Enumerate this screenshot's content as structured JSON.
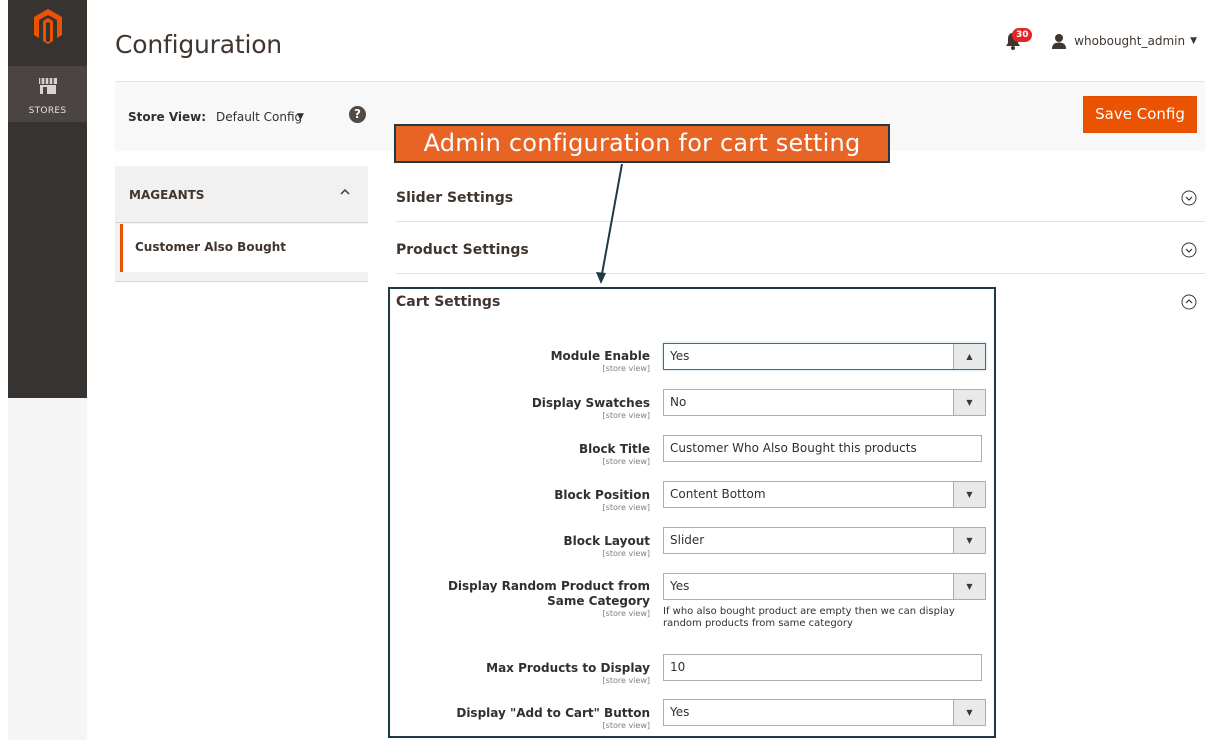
{
  "sidebar": {
    "logo_icon": "magento-logo-icon",
    "stores_label": "STORES"
  },
  "header": {
    "title": "Configuration",
    "notifications_count": "30",
    "username": "whobought_admin"
  },
  "store_view": {
    "label": "Store View:",
    "value": "Default Config"
  },
  "actions": {
    "save_label": "Save Config"
  },
  "annotation": {
    "text": "Admin configuration for cart setting"
  },
  "tabs": {
    "group_title": "MAGEANTS",
    "items": [
      {
        "label": "Customer Also Bought",
        "active": true
      }
    ]
  },
  "sections": [
    {
      "title": "Slider Settings",
      "state": "collapsed"
    },
    {
      "title": "Product Settings",
      "state": "collapsed"
    },
    {
      "title": "Cart Settings",
      "state": "expanded"
    }
  ],
  "cart_settings": {
    "fields": [
      {
        "label": "Module Enable",
        "scope": "[store view]",
        "type": "select",
        "value": "Yes",
        "open": true
      },
      {
        "label": "Display Swatches",
        "scope": "[store view]",
        "type": "select",
        "value": "No"
      },
      {
        "label": "Block Title",
        "scope": "[store view]",
        "type": "text",
        "value": "Customer Who Also Bought this products"
      },
      {
        "label": "Block Position",
        "scope": "[store view]",
        "type": "select",
        "value": "Content Bottom"
      },
      {
        "label": "Block Layout",
        "scope": "[store view]",
        "type": "select",
        "value": "Slider"
      },
      {
        "label": "Display Random Product from Same Category",
        "scope": "[store view]",
        "type": "select",
        "value": "Yes",
        "note": "If who also bought product are empty then we can display random products from same category"
      },
      {
        "label": "Max Products to Display",
        "scope": "[store view]",
        "type": "text",
        "value": "10"
      },
      {
        "label": "Display \"Add to Cart\" Button",
        "scope": "[store view]",
        "type": "select",
        "value": "Yes"
      }
    ]
  },
  "colors": {
    "brand_orange": "#eb5202",
    "rail_dark": "#373330",
    "annotation_bg": "#e76424",
    "annotation_border": "#1e3a44"
  }
}
